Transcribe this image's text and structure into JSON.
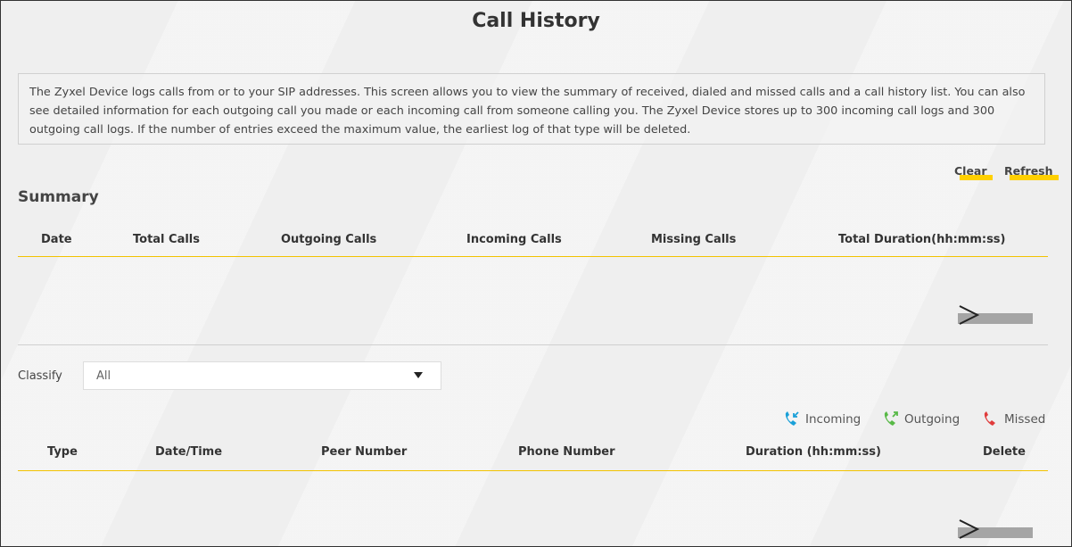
{
  "page": {
    "title": "Call History",
    "description": "The Zyxel Device logs calls from or to your SIP addresses. This screen allows you to view the summary of received, dialed and missed calls and a call history list. You can also see detailed information for each outgoing call you made or each incoming call from someone calling you. The Zyxel Device stores up to 300 incoming call logs and 300 outgoing call logs. If the number of entries exceed the maximum value, the earliest log of that type will be deleted."
  },
  "actions": {
    "clear_label": "Clear",
    "refresh_label": "Refresh"
  },
  "summary": {
    "title": "Summary",
    "columns": [
      "Date",
      "Total Calls",
      "Outgoing Calls",
      "Incoming Calls",
      "Missing Calls",
      "Total Duration(hh:mm:ss)"
    ],
    "rows": []
  },
  "filter": {
    "label": "Classify",
    "selected": "All"
  },
  "legend": {
    "incoming": "Incoming",
    "outgoing": "Outgoing",
    "missed": "Missed",
    "colors": {
      "incoming": "#1aa0d8",
      "outgoing": "#58b947",
      "missed": "#e03c3c"
    }
  },
  "history": {
    "columns": [
      "Type",
      "Date/Time",
      "Peer Number",
      "Phone Number",
      "Duration (hh:mm:ss)",
      "Delete"
    ],
    "rows": []
  },
  "theme": {
    "accent": "#ffd000",
    "divider": "#f2c200"
  }
}
